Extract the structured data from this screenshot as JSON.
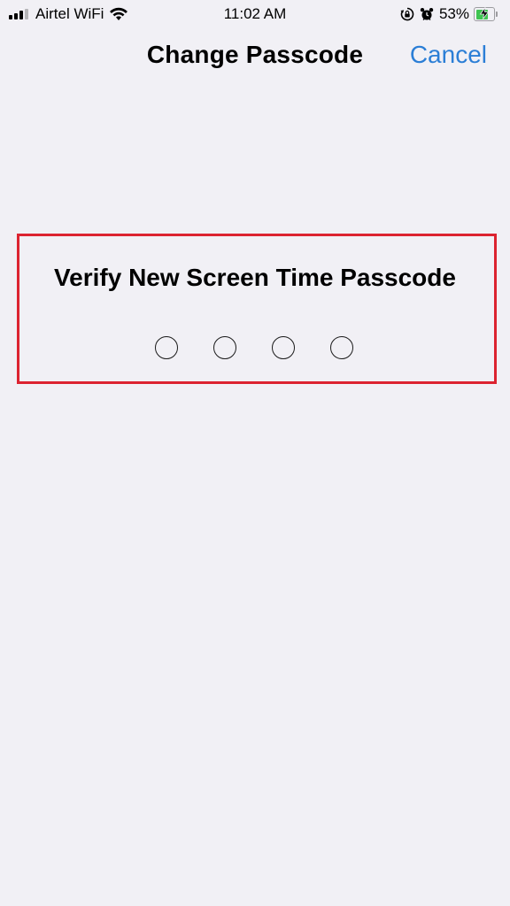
{
  "status_bar": {
    "carrier": "Airtel WiFi",
    "time": "11:02 AM",
    "battery_percent": "53%",
    "icons": [
      "cellular-signal-icon",
      "wifi-icon",
      "orientation-lock-icon",
      "alarm-icon",
      "battery-charging-icon"
    ],
    "battery_color": "#3fc451"
  },
  "nav": {
    "title": "Change Passcode",
    "cancel_label": "Cancel",
    "accent_color": "#2b7ed6"
  },
  "passcode": {
    "prompt": "Verify New Screen Time Passcode",
    "digits_total": 4,
    "digits_entered": 0
  },
  "annotation": {
    "highlight_color": "#dc2330"
  }
}
